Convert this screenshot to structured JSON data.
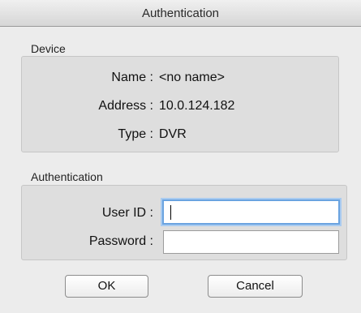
{
  "window": {
    "title": "Authentication"
  },
  "device": {
    "section_label": "Device",
    "name_label": "Name :",
    "name_value": "<no name>",
    "address_label": "Address :",
    "address_value": "10.0.124.182",
    "type_label": "Type :",
    "type_value": "DVR"
  },
  "auth": {
    "section_label": "Authentication",
    "userid_label": "User ID :",
    "userid_value": "",
    "password_label": "Password :",
    "password_value": ""
  },
  "buttons": {
    "ok_label": "OK",
    "cancel_label": "Cancel"
  }
}
